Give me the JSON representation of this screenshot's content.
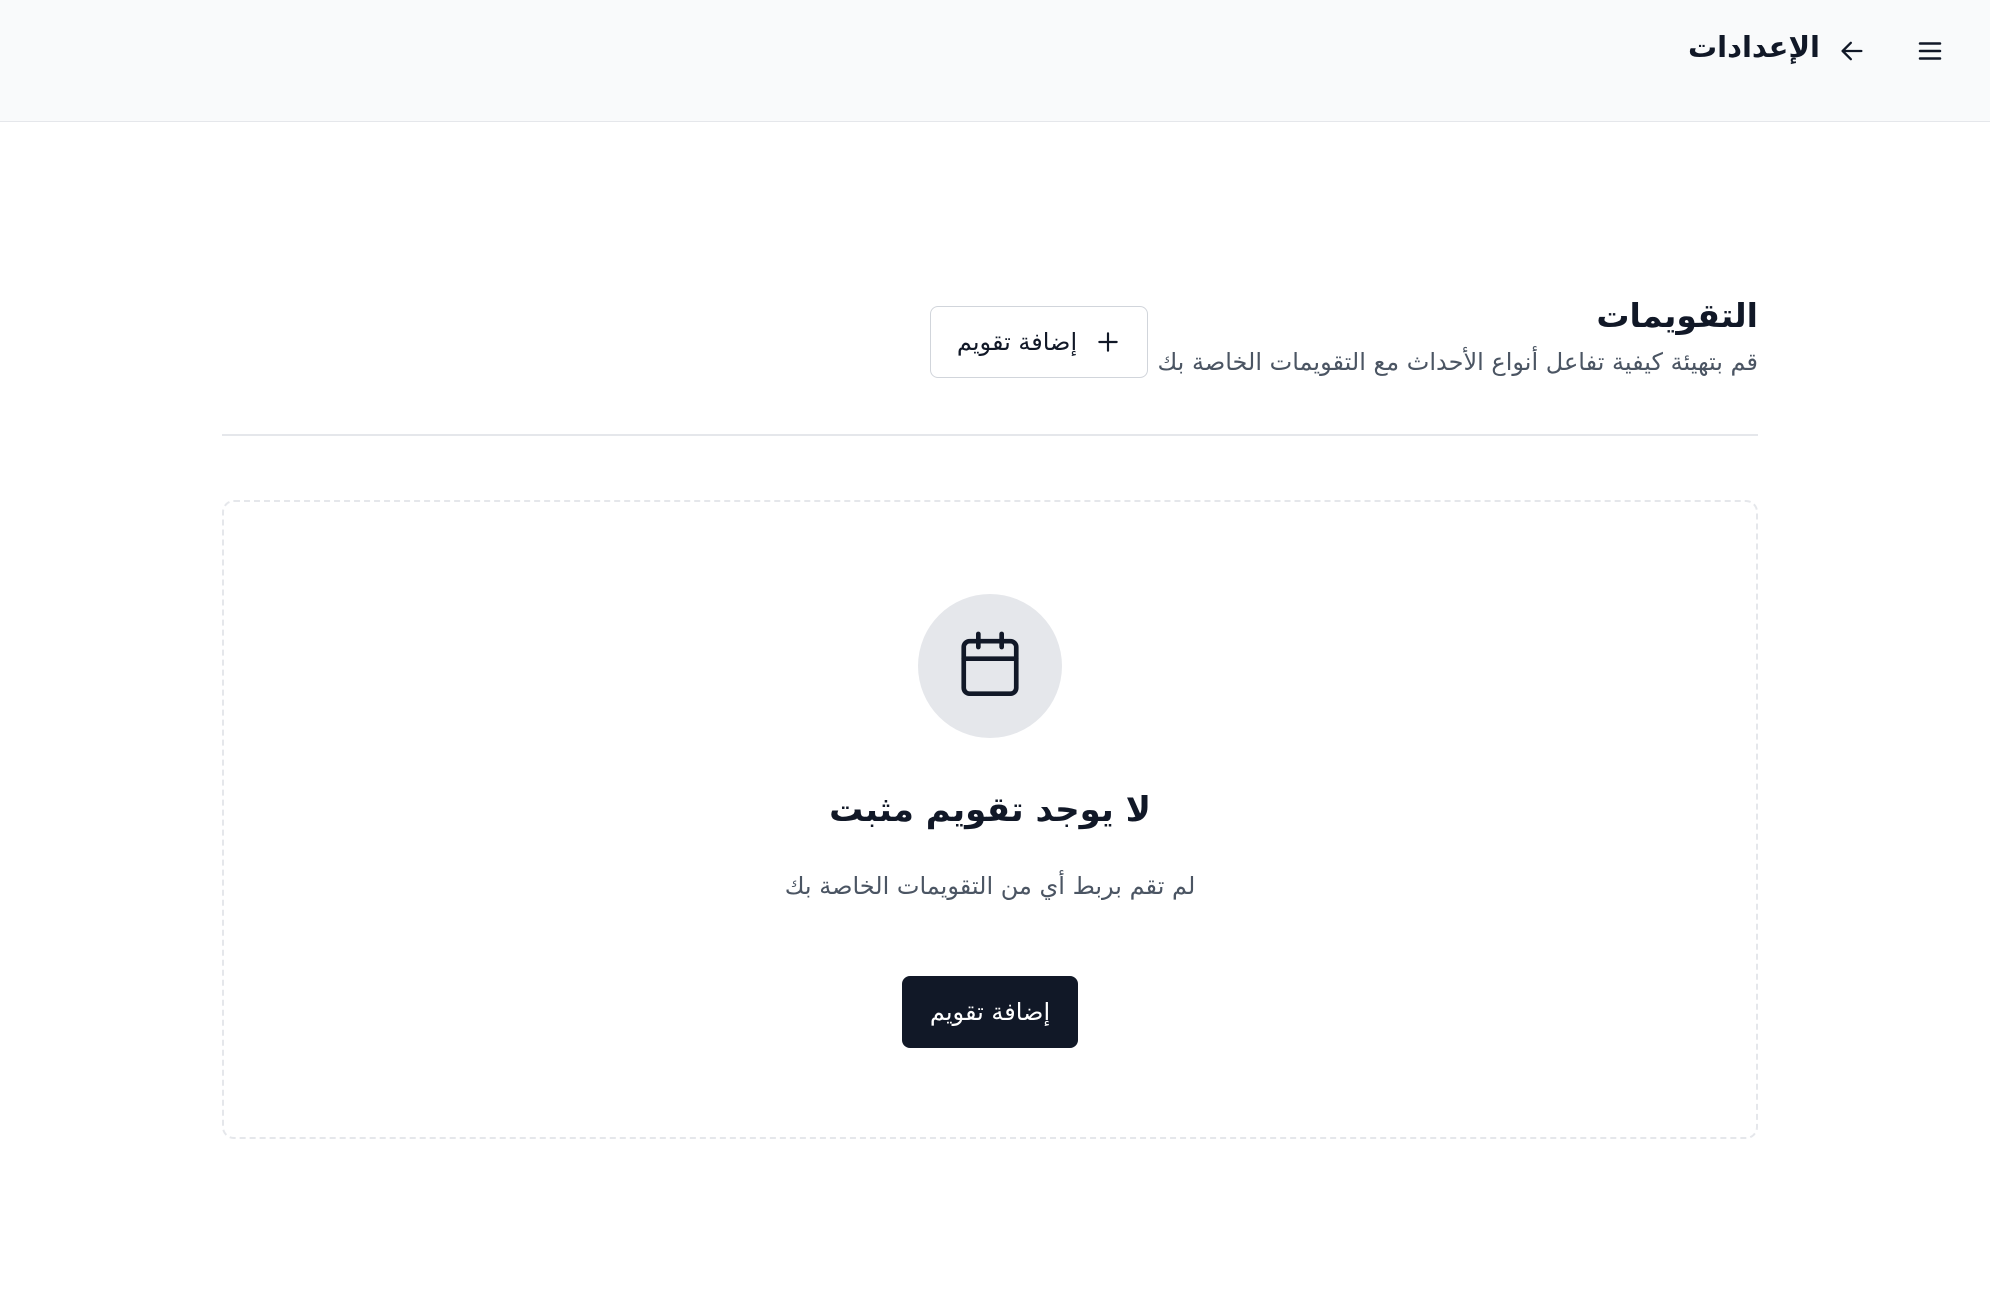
{
  "topbar": {
    "title": "الإعدادات",
    "menu_icon": "menu-icon",
    "back_icon": "arrow-left-icon"
  },
  "section": {
    "title": "التقويمات",
    "subtitle": "قم بتهيئة كيفية تفاعل أنواع الأحداث مع التقويمات الخاصة بك",
    "add_button_label": "إضافة تقويم",
    "add_button_icon": "plus-icon"
  },
  "empty_state": {
    "icon": "calendar-icon",
    "title": "لا يوجد تقويم مثبت",
    "description": "لم تقم بربط أي من التقويمات الخاصة بك",
    "button_label": "إضافة تقويم"
  },
  "colors": {
    "topbar_bg": "#f9fafb",
    "primary": "#111827",
    "muted_text": "#4b5563",
    "border": "#e5e7eb",
    "icon_circle_bg": "#e5e7eb"
  }
}
